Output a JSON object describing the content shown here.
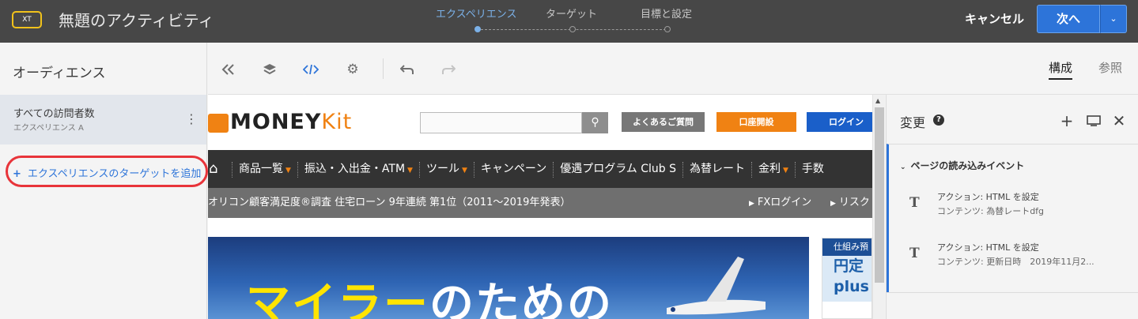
{
  "app": {
    "badge": "XT",
    "title": "無題のアクティビティ"
  },
  "steps": [
    {
      "label": "エクスペリエンス",
      "active": true
    },
    {
      "label": "ターゲット",
      "active": false
    },
    {
      "label": "目標と設定",
      "active": false
    }
  ],
  "header_actions": {
    "cancel": "キャンセル",
    "next": "次へ",
    "next_dropdown_icon": "chevron-down-icon"
  },
  "left_panel": {
    "title": "オーディエンス",
    "audience": {
      "name": "すべての訪問者数",
      "sub": "エクスペリエンス A"
    },
    "add_target": "エクスペリエンスのターゲットを追加",
    "add_icon": "+"
  },
  "toolbar": {
    "icons": [
      "collapse-icon",
      "layers-icon",
      "code-icon",
      "gear-icon",
      "undo-icon",
      "redo-icon"
    ],
    "view_tabs": [
      {
        "label": "構成",
        "active": true
      },
      {
        "label": "参照",
        "active": false
      }
    ]
  },
  "site": {
    "logo": "MONEY",
    "logo_accent": "Kit",
    "faq_button": "よくあるご質問",
    "open_account_button": "口座開設",
    "login_button": "ログイン",
    "nav": [
      {
        "label": "商品一覧",
        "dropdown": true
      },
      {
        "label": "振込・入出金・ATM",
        "dropdown": true
      },
      {
        "label": "ツール",
        "dropdown": true
      },
      {
        "label": "キャンペーン",
        "dropdown": false
      },
      {
        "label": "優遇プログラム Club S",
        "dropdown": false
      },
      {
        "label": "為替レート",
        "dropdown": false
      },
      {
        "label": "金利",
        "dropdown": true
      },
      {
        "label": "手数",
        "dropdown": false
      }
    ],
    "sub_message": "オリコン顧客満足度®調査 住宅ローン 9年連続 第1位（2011～2019年発表）",
    "sub_link_1": "FXログイン",
    "sub_link_2": "リスク",
    "banner_yellow": "マイラー",
    "banner_white": "のための",
    "side_card_head": "仕組み預",
    "side_card_line1": "円定",
    "side_card_line2": "plus"
  },
  "right_panel": {
    "title": "変更",
    "help": "?",
    "group_title": "ページの読み込みイベント",
    "actions": [
      {
        "line1": "アクション: HTML を設定",
        "line2": "コンテンツ: 為替レートdfg"
      },
      {
        "line1": "アクション: HTML を設定",
        "line2": "コンテンツ: 更新日時　2019年11月2..."
      }
    ]
  },
  "colors": {
    "topbar": "#474747",
    "accent_blue": "#2d74d9",
    "step_active": "#7bb1e8",
    "brand_orange": "#f08213",
    "highlight_ring": "#e8343a"
  }
}
